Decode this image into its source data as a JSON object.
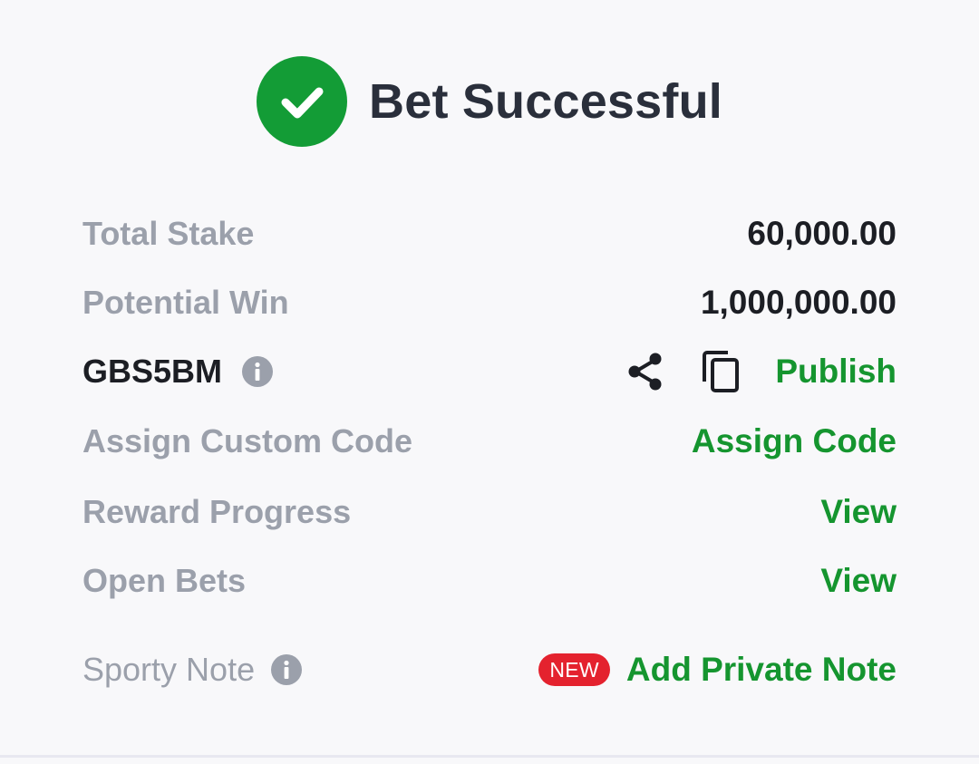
{
  "header": {
    "title": "Bet Successful",
    "icon": "check-circle-icon",
    "accent_color": "#139c36"
  },
  "rows": {
    "total_stake": {
      "label": "Total Stake",
      "value": "60,000.00"
    },
    "potential_win": {
      "label": "Potential Win",
      "value": "1,000,000.00"
    },
    "booking_code": {
      "code": "GBS5BM",
      "info_icon": "info-icon",
      "share_icon": "share-icon",
      "copy_icon": "copy-icon",
      "publish_label": "Publish"
    },
    "custom_code": {
      "label": "Assign Custom Code",
      "action": "Assign Code"
    },
    "reward_progress": {
      "label": "Reward Progress",
      "action": "View"
    },
    "open_bets": {
      "label": "Open Bets",
      "action": "View"
    },
    "sporty_note": {
      "label": "Sporty Note",
      "info_icon": "info-icon",
      "badge": "NEW",
      "action": "Add Private Note"
    }
  },
  "colors": {
    "link_green": "#15952f",
    "muted_label": "#9ba0ab",
    "dark_text": "#1c1e24",
    "badge_red": "#e4222e"
  }
}
